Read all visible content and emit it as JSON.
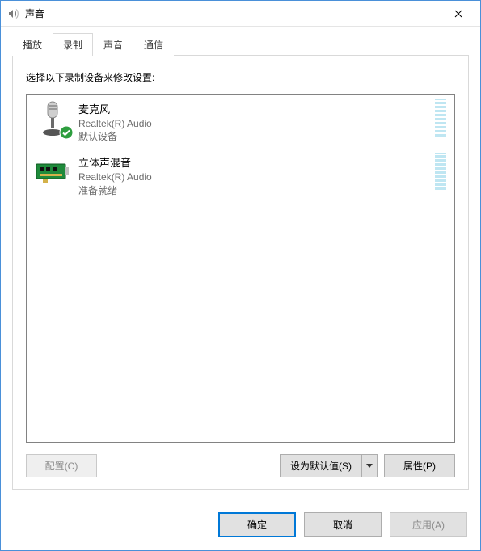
{
  "window": {
    "title": "声音"
  },
  "tabs": [
    {
      "id": "playback",
      "label": "播放"
    },
    {
      "id": "recording",
      "label": "录制"
    },
    {
      "id": "sounds",
      "label": "声音"
    },
    {
      "id": "comm",
      "label": "通信"
    }
  ],
  "active_tab": "recording",
  "instruction": "选择以下录制设备来修改设置:",
  "devices": [
    {
      "name": "麦克风",
      "driver": "Realtek(R) Audio",
      "status": "默认设备",
      "default": true,
      "icon": "microphone"
    },
    {
      "name": "立体声混音",
      "driver": "Realtek(R) Audio",
      "status": "准备就绪",
      "default": false,
      "icon": "soundcard"
    }
  ],
  "panel_buttons": {
    "configure": "配置(C)",
    "set_default": "设为默认值(S)",
    "properties": "属性(P)"
  },
  "dialog_buttons": {
    "ok": "确定",
    "cancel": "取消",
    "apply": "应用(A)"
  }
}
